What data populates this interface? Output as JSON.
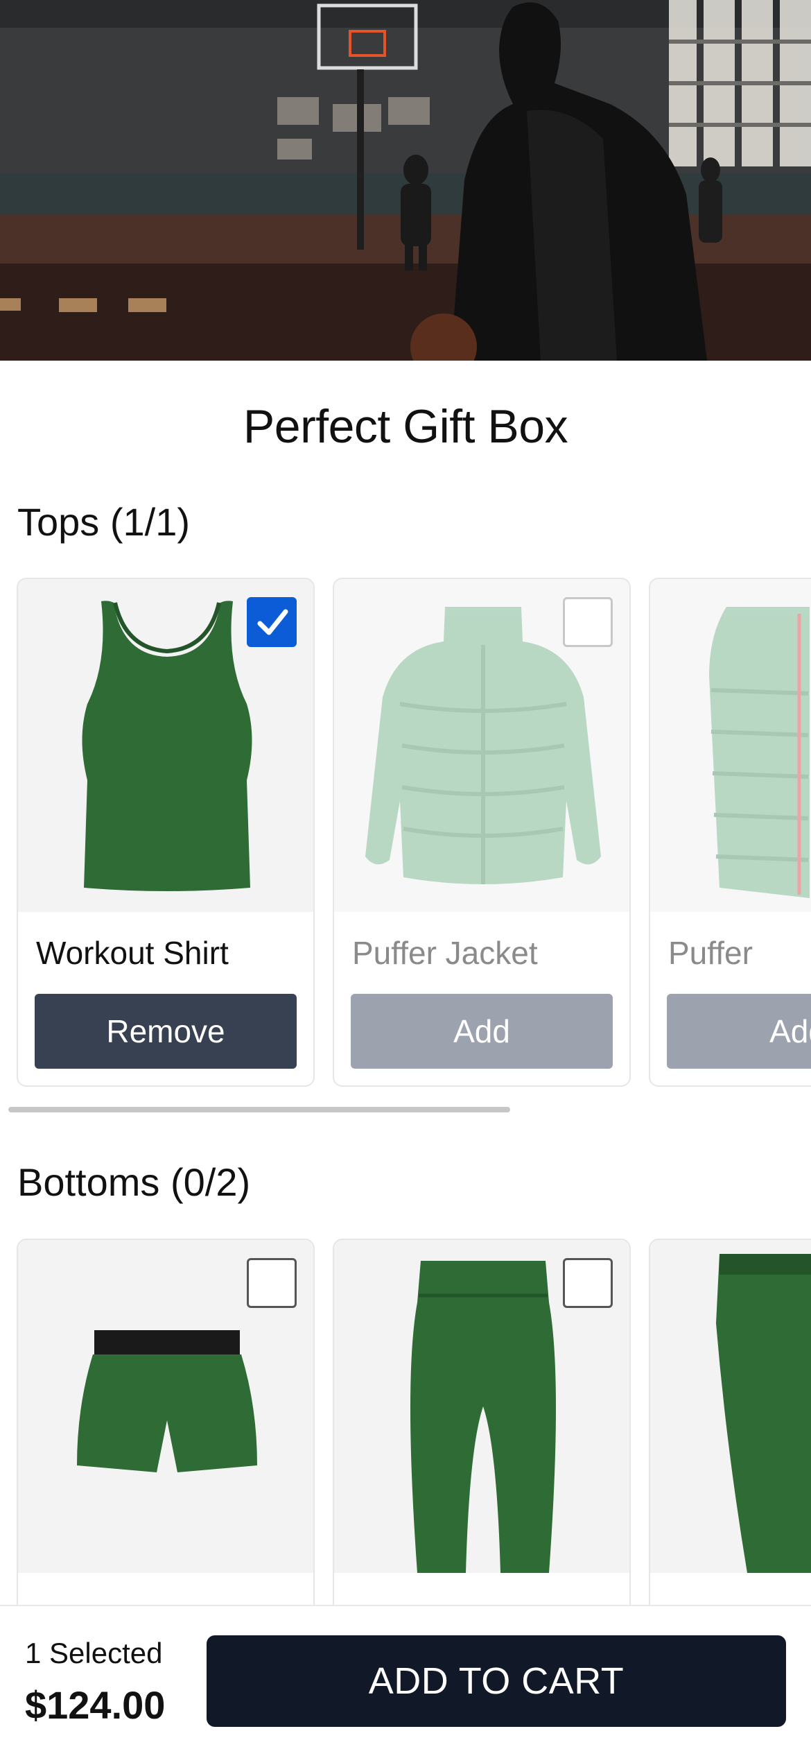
{
  "hero": {
    "alt": "Basketball player in hoodie in a gym"
  },
  "page_title": "Perfect Gift Box",
  "sections": [
    {
      "heading": "Tops (1/1)",
      "products": [
        {
          "name": "Workout Shirt",
          "button": "Remove",
          "selected": true,
          "icon": "tank-top-icon"
        },
        {
          "name": "Puffer Jacket",
          "button": "Add",
          "selected": false,
          "icon": "puffer-jacket-icon"
        },
        {
          "name": "Puffer",
          "button": "Add",
          "selected": false,
          "icon": "puffer-vest-icon"
        }
      ]
    },
    {
      "heading": "Bottoms (0/2)",
      "products": [
        {
          "name": "",
          "button": "",
          "selected": false,
          "icon": "shorts-icon"
        },
        {
          "name": "",
          "button": "",
          "selected": false,
          "icon": "leggings-icon"
        },
        {
          "name": "",
          "button": "",
          "selected": false,
          "icon": "joggers-icon"
        }
      ]
    }
  ],
  "footer": {
    "selected_count": "1 Selected",
    "total_price": "$124.00",
    "cta_label": "ADD TO CART"
  },
  "colors": {
    "remove_button": "#374151",
    "add_button": "#9ca3af",
    "checkbox_checked": "#0b5cd6",
    "cart_button": "#111827",
    "product_green": "#2e6b35"
  }
}
